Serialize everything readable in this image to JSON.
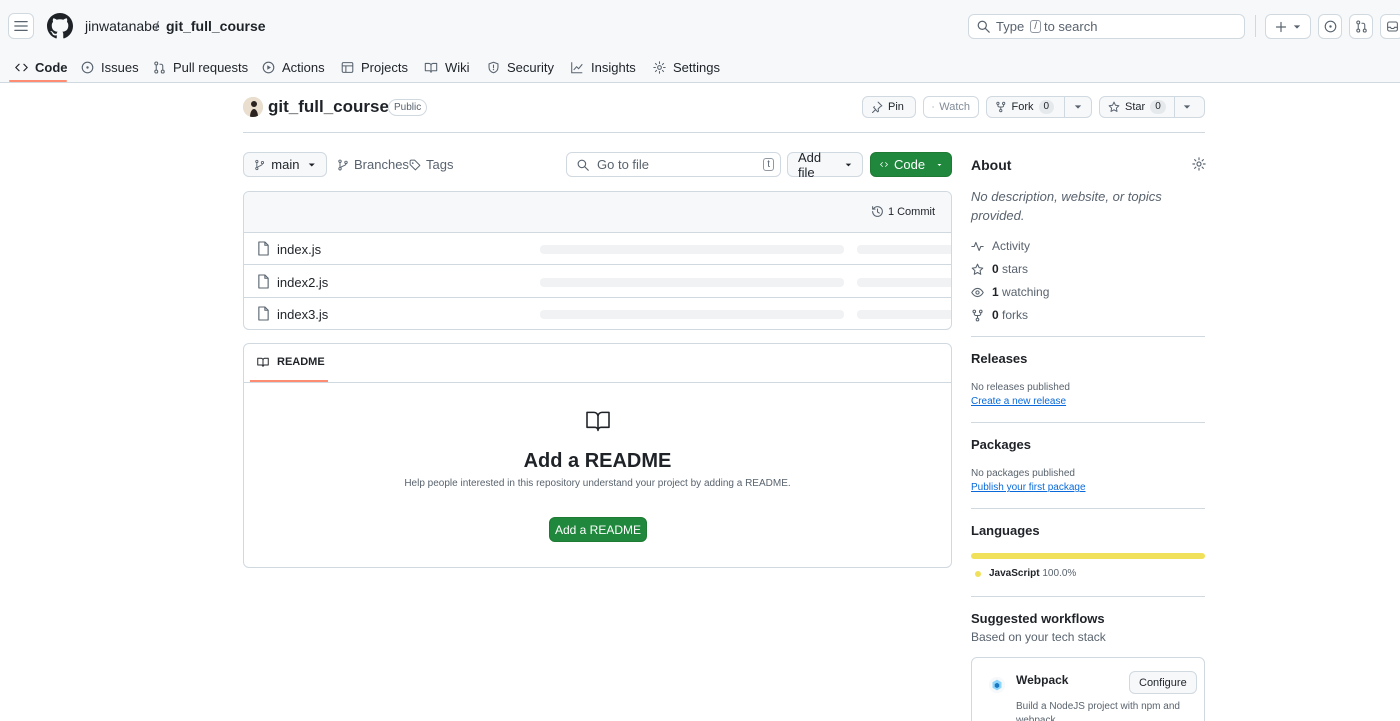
{
  "header": {
    "owner": "jinwatanabe",
    "separator": "/",
    "repo": "git_full_course",
    "search_prefix": "Type",
    "search_key": "/",
    "search_suffix": "to search"
  },
  "nav": {
    "tabs": [
      {
        "label": "Code",
        "icon": "code-icon",
        "active": true
      },
      {
        "label": "Issues",
        "icon": "issue-icon"
      },
      {
        "label": "Pull requests",
        "icon": "pull-request-icon"
      },
      {
        "label": "Actions",
        "icon": "play-icon"
      },
      {
        "label": "Projects",
        "icon": "table-icon"
      },
      {
        "label": "Wiki",
        "icon": "book-icon"
      },
      {
        "label": "Security",
        "icon": "shield-icon"
      },
      {
        "label": "Insights",
        "icon": "graph-icon"
      },
      {
        "label": "Settings",
        "icon": "gear-icon"
      }
    ]
  },
  "repo": {
    "name": "git_full_course",
    "visibility": "Public",
    "pin_label": "Pin",
    "watch_label": "Watch",
    "fork_label": "Fork",
    "fork_count": "0",
    "star_label": "Star",
    "star_count": "0"
  },
  "toolbar": {
    "branch": "main",
    "branches_label": "Branches",
    "tags_label": "Tags",
    "goto_placeholder": "Go to file",
    "goto_key": "t",
    "add_file_label": "Add file",
    "code_label": "Code"
  },
  "files": {
    "commit_label": "1 Commit",
    "items": [
      {
        "name": "index.js"
      },
      {
        "name": "index2.js"
      },
      {
        "name": "index3.js"
      }
    ]
  },
  "readme": {
    "tab_label": "README",
    "title": "Add a README",
    "description": "Help people interested in this repository understand your project by adding a README.",
    "button_label": "Add a README"
  },
  "about": {
    "heading": "About",
    "description": "No description, website, or topics provided.",
    "activity_label": "Activity",
    "stars_count": "0",
    "stars_label": "stars",
    "watching_count": "1",
    "watching_label": "watching",
    "forks_count": "0",
    "forks_label": "forks"
  },
  "releases": {
    "heading": "Releases",
    "empty": "No releases published",
    "link": "Create a new release"
  },
  "packages": {
    "heading": "Packages",
    "empty": "No packages published",
    "link": "Publish your first package"
  },
  "languages": {
    "heading": "Languages",
    "items": [
      {
        "name": "JavaScript",
        "percent": "100.0%",
        "fraction": 1.0,
        "color": "#f1e05a"
      }
    ]
  },
  "workflows": {
    "heading": "Suggested workflows",
    "subheading": "Based on your tech stack",
    "items": [
      {
        "name": "Webpack",
        "description": "Build a NodeJS project with npm and webpack.",
        "button": "Configure"
      }
    ]
  },
  "colors": {
    "accent_green": "#1f883d",
    "tab_underline": "#fd8c73",
    "link_blue": "#0969da"
  }
}
